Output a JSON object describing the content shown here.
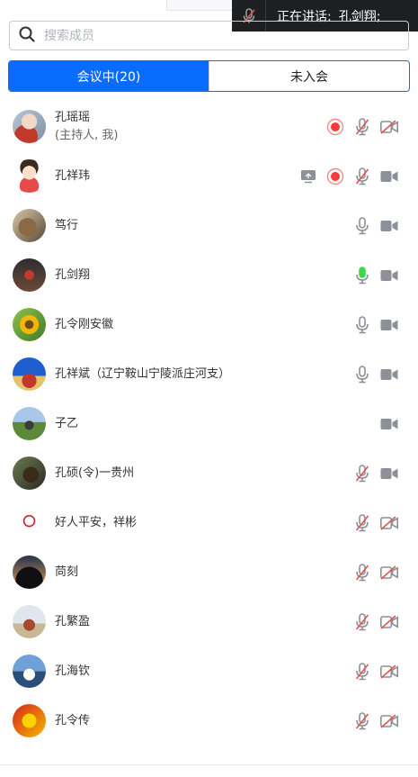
{
  "speaking": {
    "label": "正在讲话:",
    "names": "孔剑翔;"
  },
  "search": {
    "placeholder": "搜索成员"
  },
  "tabs": [
    {
      "label": "会议中(20)",
      "active": true
    },
    {
      "label": "未入会",
      "active": false
    }
  ],
  "members": [
    {
      "name": "孔瑶瑶",
      "sub": "(主持人, 我)",
      "icons": [
        "record",
        "mic-off",
        "cam-off"
      ]
    },
    {
      "name": "孔祥玮",
      "sub": "",
      "icons": [
        "share",
        "record",
        "mic-off",
        "cam"
      ]
    },
    {
      "name": "笃行",
      "sub": "",
      "icons": [
        "mic",
        "cam"
      ]
    },
    {
      "name": "孔剑翔",
      "sub": "",
      "icons": [
        "mic-active",
        "cam"
      ]
    },
    {
      "name": "孔令刚安徽",
      "sub": "",
      "icons": [
        "mic",
        "cam"
      ]
    },
    {
      "name": "孔祥斌（辽宁鞍山宁陵派庄河支）",
      "sub": "",
      "icons": [
        "mic",
        "cam"
      ]
    },
    {
      "name": "子乙",
      "sub": "",
      "icons": [
        "cam"
      ]
    },
    {
      "name": "孔硕(令)一贵州",
      "sub": "",
      "icons": [
        "mic-off",
        "cam"
      ]
    },
    {
      "name": "好人平安，祥彬",
      "sub": "",
      "icons": [
        "mic-off",
        "cam-off"
      ]
    },
    {
      "name": "苘刻",
      "sub": "",
      "icons": [
        "mic-off",
        "cam-off"
      ]
    },
    {
      "name": "孔繁盈",
      "sub": "",
      "icons": [
        "mic-off",
        "cam-off"
      ]
    },
    {
      "name": "孔海钦",
      "sub": "",
      "icons": [
        "mic-off",
        "cam-off"
      ]
    },
    {
      "name": "孔令传",
      "sub": "",
      "icons": [
        "mic-off",
        "cam-off"
      ]
    }
  ],
  "colors": {
    "accent": "#0a6cff",
    "record": "#f23b3b",
    "mic_off": "#e0554f",
    "mic_active": "#3fd84a",
    "icon_gray": "#8c9097"
  }
}
